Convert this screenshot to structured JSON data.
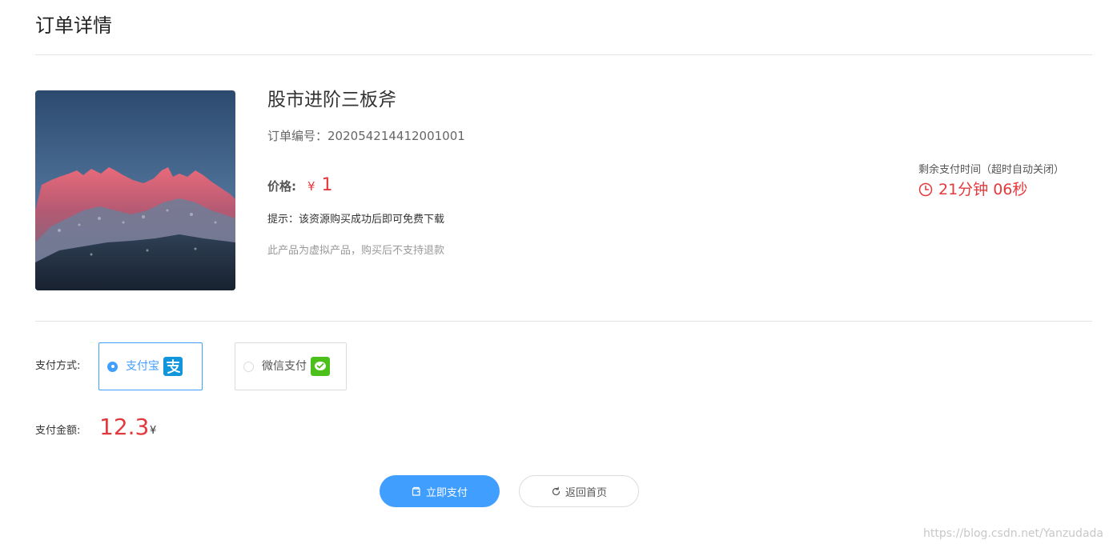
{
  "header": {
    "title": "订单详情"
  },
  "product": {
    "image": "mountain-sunset-image",
    "name": "股市进阶三板斧",
    "order_label": "订单编号：",
    "order_number": "202054214412001001",
    "price_label": "价格:",
    "price_currency": "¥",
    "price_value": "1",
    "tip": "提示：该资源购买成功后即可免费下载",
    "notice": "此产品为虚拟产品，购买后不支持退款"
  },
  "countdown": {
    "label": "剩余支付时间（超时自动关闭）",
    "value": "21分钟 06秒",
    "icon": "clock-icon"
  },
  "payment": {
    "method_label": "支付方式:",
    "options": [
      {
        "label": "支付宝",
        "icon": "alipay-icon",
        "selected": true,
        "color": "#1296db"
      },
      {
        "label": "微信支付",
        "icon": "wechat-pay-icon",
        "selected": false,
        "color": "#4bbf1a"
      }
    ],
    "amount_label": "支付金额:",
    "amount_value": "12.3",
    "amount_currency": "¥"
  },
  "actions": {
    "pay_now": "立即支付",
    "back_home": "返回首页"
  },
  "watermark": "https://blog.csdn.net/Yanzudada",
  "colors": {
    "accent": "#409eff",
    "price": "#e4393c"
  }
}
